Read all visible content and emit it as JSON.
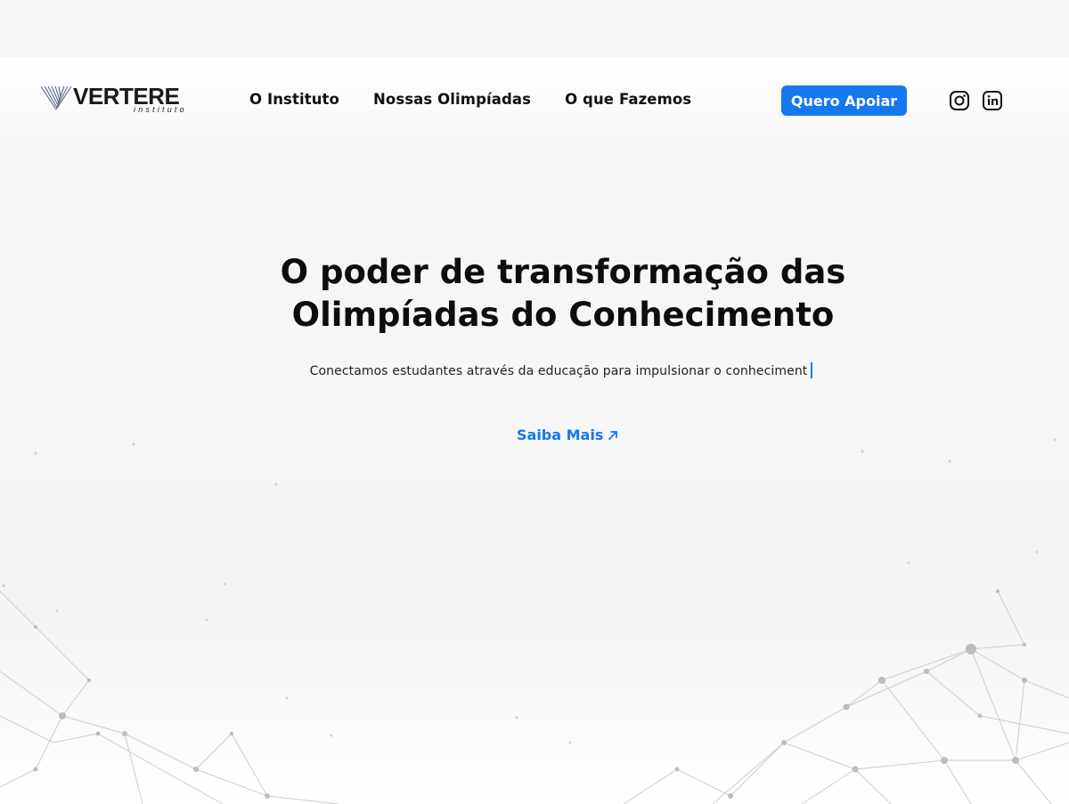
{
  "brand": {
    "name": "VERTERE",
    "sub": "instituto"
  },
  "nav": {
    "items": [
      {
        "label": "O Instituto"
      },
      {
        "label": "Nossas Olimpíadas"
      },
      {
        "label": "O que Fazemos"
      }
    ],
    "cta_label": "Quero Apoiar"
  },
  "social": {
    "icons": [
      "instagram-icon",
      "linkedin-icon"
    ]
  },
  "hero": {
    "title_line1": "O poder de transformação das",
    "title_line2": "Olimpíadas do Conhecimento",
    "subtitle": "Conectamos estudantes através da educação para impulsionar o conheciment",
    "more_label": "Saiba Mais"
  },
  "colors": {
    "accent": "#1478f0",
    "text": "#111111",
    "background": "#f7f7f7"
  }
}
